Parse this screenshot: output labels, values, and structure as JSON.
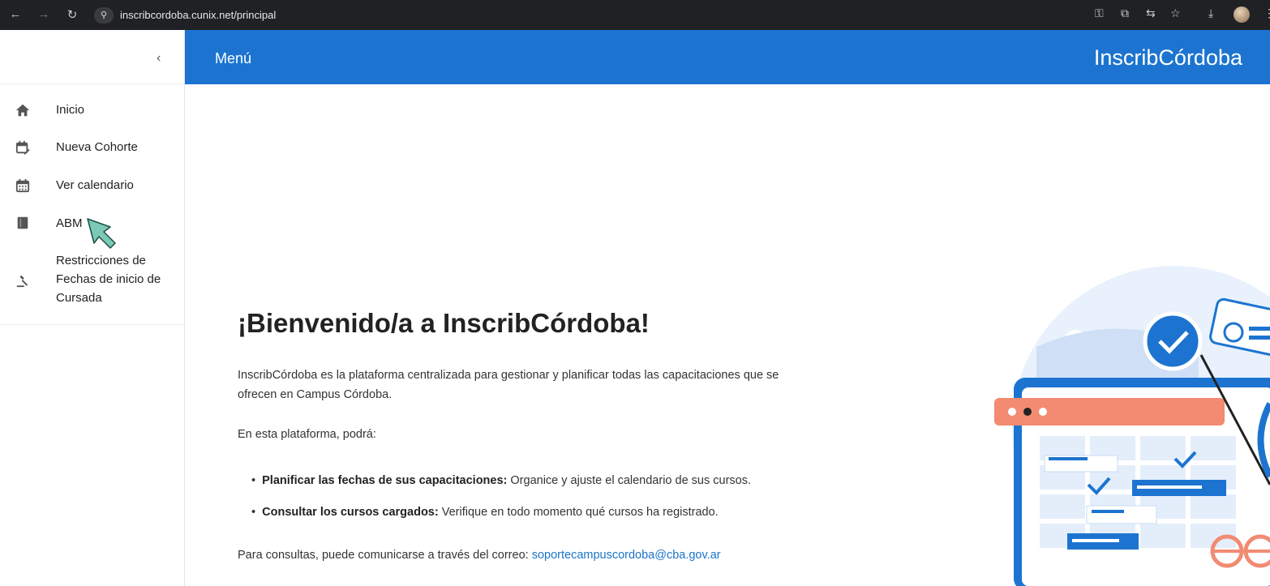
{
  "browser": {
    "url": "inscribcordoba.cunix.net/principal"
  },
  "sidebar": {
    "collapse_icon": "chevron-left-icon",
    "items": [
      {
        "label": "Inicio",
        "icon": "home-icon"
      },
      {
        "label": "Nueva Cohorte",
        "icon": "calendar-edit-icon"
      },
      {
        "label": "Ver calendario",
        "icon": "calendar-icon"
      },
      {
        "label": "ABM",
        "icon": "book-icon"
      },
      {
        "label": "Restricciones de Fechas de inicio de Cursada",
        "label_lines": [
          "Restricciones de",
          "Fechas de inicio de",
          "Cursada"
        ],
        "icon": "gavel-icon"
      }
    ]
  },
  "header": {
    "menu_label": "Menú",
    "brand": "InscribCórdoba",
    "color": "#1c74d0"
  },
  "main": {
    "title": "¡Bienvenido/a a InscribCórdoba!",
    "intro": "InscribCórdoba es la plataforma centralizada para gestionar y planificar todas las capacitaciones que se ofrecen en Campus Córdoba.",
    "lead": "En esta plataforma, podrá:",
    "bullets": [
      {
        "bold": "Planificar las fechas de sus capacitaciones:",
        "text": " Organice y ajuste el calendario de sus cursos."
      },
      {
        "bold": "Consultar los cursos cargados:",
        "text": " Verifique en todo momento qué cursos ha registrado."
      }
    ],
    "contact_text": "Para consultas, puede comunicarse a través del correo: ",
    "contact_email": "soportecampuscordoba@cba.gov.ar",
    "link_color": "#1a73c9"
  }
}
